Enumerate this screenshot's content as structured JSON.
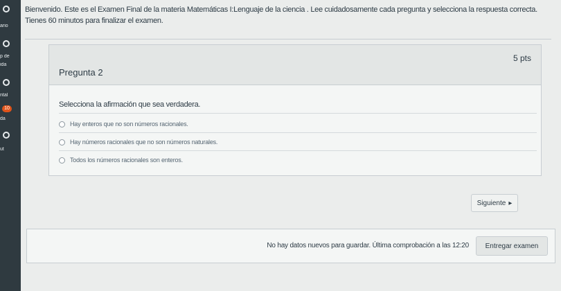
{
  "nav": {
    "fragments": [
      "ario",
      "p de",
      "ida",
      "ntal",
      "da",
      "ut"
    ],
    "badge": "10"
  },
  "intro": {
    "text": "Bienvenido. Este es el Examen Final de la materia Matemáticas I:Lenguaje de la ciencia . Lee cuidadosamente cada pregunta y selecciona la respuesta correcta. Tienes 60 minutos para finalizar el examen."
  },
  "question": {
    "title": "Pregunta 2",
    "points": "5 pts",
    "prompt": "Selecciona la afirmación que sea verdadera.",
    "answers": [
      "Hay enteros que no son números racionales.",
      "Hay números racionales que no son números naturales.",
      "Todos los números racionales son enteros."
    ]
  },
  "navigation": {
    "next_label": "Siguiente",
    "next_arrow": "▸"
  },
  "footer": {
    "status": "No hay datos nuevos para guardar. Última comprobación a las 12:20",
    "submit_label": "Entregar examen"
  }
}
